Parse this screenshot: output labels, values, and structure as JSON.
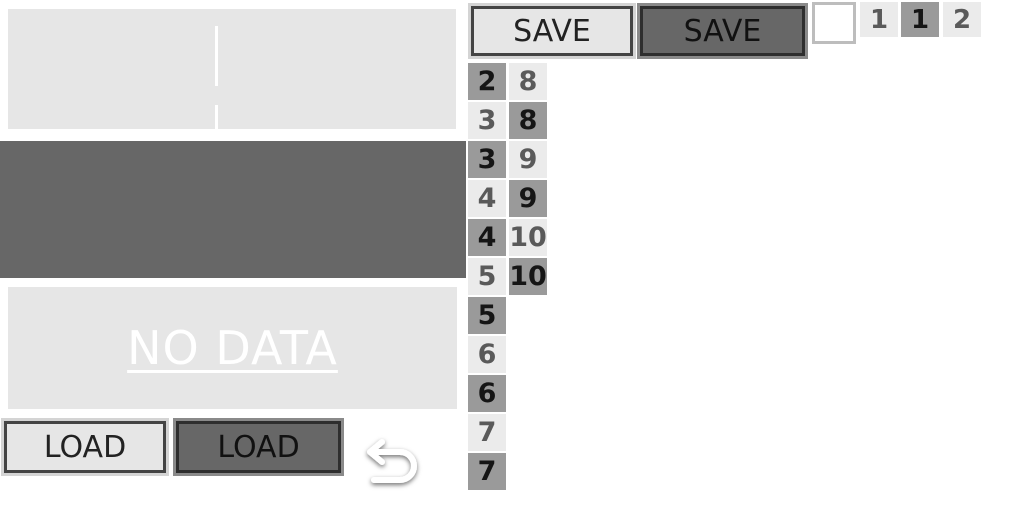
{
  "left": {
    "empty_label": "NO DATA",
    "load_buttons": [
      "LOAD",
      "LOAD"
    ],
    "undo_icon": "undo-arrow-icon"
  },
  "top": {
    "save_buttons": [
      "SAVE",
      "SAVE"
    ],
    "pages": [
      "1",
      "1",
      "2"
    ]
  },
  "grid": {
    "col1": [
      "2",
      "3",
      "3",
      "4",
      "4",
      "5",
      "5",
      "6",
      "6",
      "7",
      "7"
    ],
    "col2": [
      "8",
      "8",
      "9",
      "9",
      "10",
      "10"
    ]
  }
}
